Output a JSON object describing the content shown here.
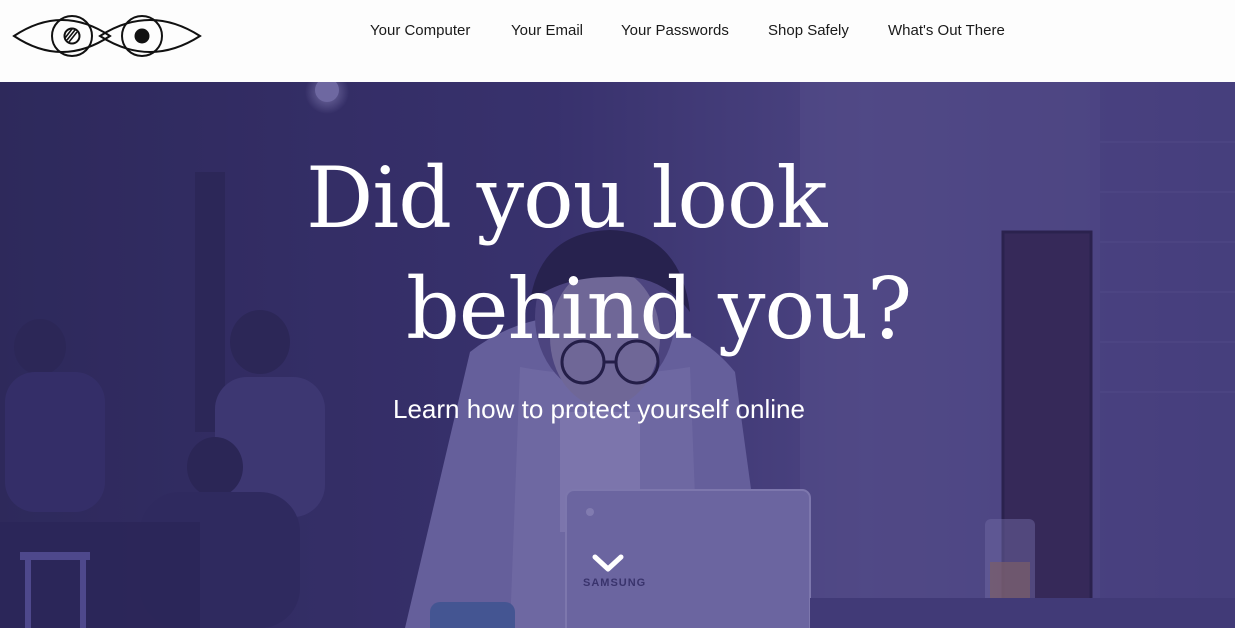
{
  "header": {
    "logo": {
      "icon": "eyes-logo-icon"
    },
    "nav": [
      {
        "label": "Your Computer"
      },
      {
        "label": "Your Email"
      },
      {
        "label": "Your Passwords"
      },
      {
        "label": "Shop Safely"
      },
      {
        "label": "What's Out There"
      }
    ]
  },
  "hero": {
    "title_line_1": "Did you look",
    "title_line_2": "behind you?",
    "subtitle": "Learn how to protect yourself online",
    "scroll_icon": "chevron-down-icon",
    "overlay_color": "#3b3470",
    "laptop_brand": "SAMSUNG"
  }
}
